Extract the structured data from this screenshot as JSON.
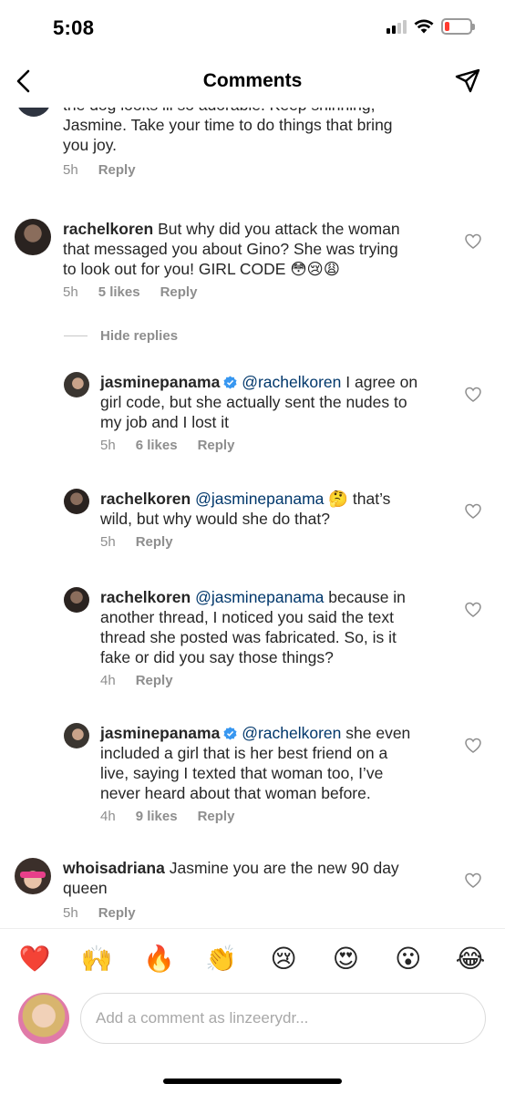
{
  "status_bar": {
    "time": "5:08"
  },
  "header": {
    "title": "Comments"
  },
  "comments": [
    {
      "user": "",
      "text_lines": [
        "the dog looks lil so adorable. Keep shinning,",
        "Jasmine. Take your time to do things that bring",
        "you joy."
      ],
      "time": "5h",
      "likes": "",
      "reply_label": "Reply"
    },
    {
      "user": "rachelkoren",
      "text_lines": [
        "But why did you attack the woman",
        "that messaged you about Gino? She was trying",
        "to look out for you! GIRL CODE 😳😢😩"
      ],
      "time": "5h",
      "likes": "5 likes",
      "reply_label": "Reply"
    }
  ],
  "hide_replies_label": "Hide replies",
  "replies": [
    {
      "user": "jasminepanama",
      "verified": true,
      "mention": "@rachelkoren",
      "line1_rest": " I agree on",
      "lines": [
        "girl code, but she actually sent the nudes to",
        "my job and I lost it"
      ],
      "time": "5h",
      "likes": "6 likes",
      "reply_label": "Reply"
    },
    {
      "user": "rachelkoren",
      "verified": false,
      "mention": "@jasminepanama",
      "line1_rest": " 🤔 that’s",
      "lines": [
        "wild, but why would she do that?"
      ],
      "time": "5h",
      "likes": "",
      "reply_label": "Reply"
    },
    {
      "user": "rachelkoren",
      "verified": false,
      "mention": "@jasminepanama",
      "line1_rest": " because in",
      "lines": [
        "another thread, I noticed you said the text",
        "thread she posted was fabricated. So, is it",
        "fake or did you say those things?"
      ],
      "time": "4h",
      "likes": "",
      "reply_label": "Reply"
    },
    {
      "user": "jasminepanama",
      "verified": true,
      "mention": "@rachelkoren",
      "line1_rest": " she even",
      "lines": [
        "included a girl that is her best friend on a",
        "live, saying I texted that woman too, I’ve",
        "never heard about that woman before."
      ],
      "time": "4h",
      "likes": "9 likes",
      "reply_label": "Reply"
    }
  ],
  "last_comment": {
    "user": "whoisadriana",
    "text_lines": [
      "Jasmine you are the new 90 day",
      "queen"
    ],
    "time": "5h",
    "reply_label": "Reply"
  },
  "emoji_bar": [
    "❤️",
    "🙌",
    "🔥",
    "👏",
    "😢",
    "😍",
    "😮",
    "😂"
  ],
  "input": {
    "placeholder": "Add a comment as linzeerydr..."
  },
  "colors": {
    "mention": "#00376b",
    "secondary_text": "#8e8e8e",
    "battery_low": "#ff3b30"
  },
  "battery_level_fraction": 0.2
}
